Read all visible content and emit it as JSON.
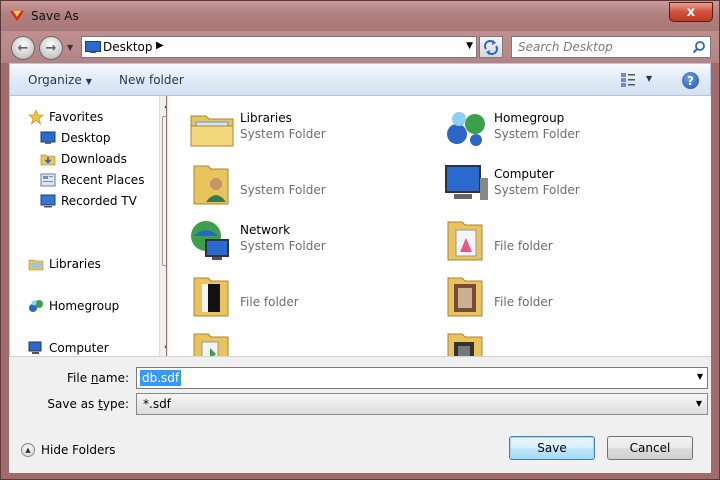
{
  "window": {
    "title": "Save As",
    "close_label": "x"
  },
  "address": {
    "location": "Desktop",
    "search_placeholder": "Search Desktop"
  },
  "toolbar": {
    "organize_label": "Organize",
    "new_folder_label": "New folder",
    "help_label": "?"
  },
  "nav": {
    "favorites": {
      "label": "Favorites",
      "icon": "star-icon"
    },
    "favorite_items": [
      {
        "label": "Desktop",
        "icon": "desktop-icon"
      },
      {
        "label": "Downloads",
        "icon": "downloads-icon"
      },
      {
        "label": "Recent Places",
        "icon": "recent-places-icon"
      },
      {
        "label": "Recorded TV",
        "icon": "recorded-tv-icon"
      }
    ],
    "libraries": {
      "label": "Libraries",
      "icon": "libraries-icon"
    },
    "homegroup": {
      "label": "Homegroup",
      "icon": "homegroup-icon"
    },
    "computer": {
      "label": "Computer",
      "icon": "computer-icon"
    }
  },
  "items": [
    {
      "name": "Libraries",
      "type": "System Folder",
      "icon": "libraries-folder-icon"
    },
    {
      "name": "Homegroup",
      "type": "System Folder",
      "icon": "homegroup-icon"
    },
    {
      "name": "",
      "type": "System Folder",
      "icon": "user-folder-icon"
    },
    {
      "name": "Computer",
      "type": "System Folder",
      "icon": "computer-icon"
    },
    {
      "name": "Network",
      "type": "System Folder",
      "icon": "network-icon"
    },
    {
      "name": "",
      "type": "File folder",
      "icon": "folder-icon"
    },
    {
      "name": "",
      "type": "File folder",
      "icon": "folder-icon"
    },
    {
      "name": "",
      "type": "File folder",
      "icon": "folder-icon"
    },
    {
      "name": "",
      "type": "",
      "icon": "folder-icon"
    },
    {
      "name": "",
      "type": "",
      "icon": "folder-icon"
    }
  ],
  "form": {
    "filename_label": "File name:",
    "filename_value": "db.sdf",
    "savetype_label_pre": "Save as ",
    "savetype_label_key": "t",
    "savetype_label_post": "ype:",
    "savetype_value": "*.sdf",
    "filename_label_key": "n",
    "filename_label_pre": "File ",
    "filename_label_post": "ame:"
  },
  "footer": {
    "hide_folders_label": "Hide Folders",
    "save_label": "Save",
    "cancel_label": "Cancel"
  },
  "colors": {
    "titlebar": "#b07f7f",
    "selection": "#3399ff",
    "toolbar": "#dfe9f5"
  }
}
